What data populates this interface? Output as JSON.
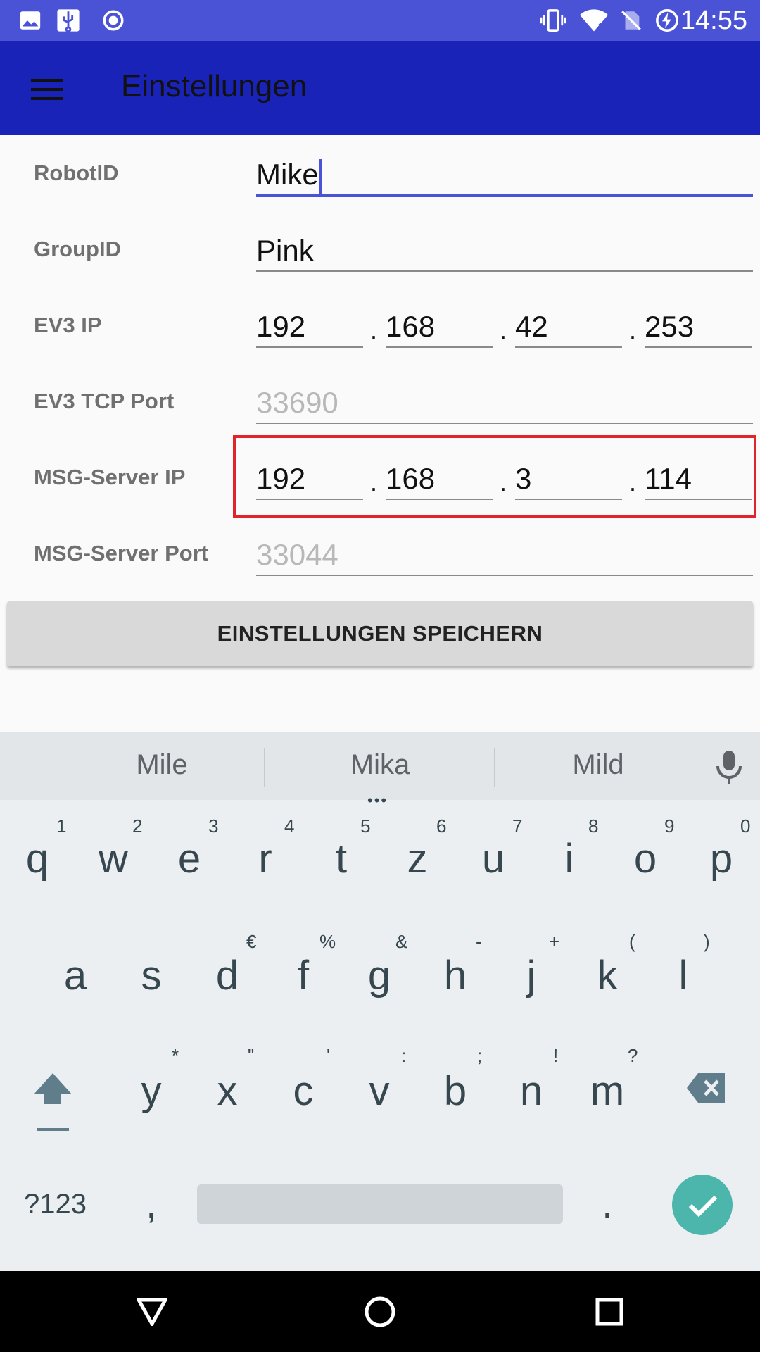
{
  "status_bar": {
    "time": "14:55",
    "left_icons": [
      "image-icon",
      "usb-icon",
      "record-icon"
    ],
    "right_icons": [
      "vibrate-icon",
      "wifi-icon",
      "no-sim-icon",
      "battery-charging-icon"
    ]
  },
  "app_bar": {
    "title": "Einstellungen",
    "menu_icon": "hamburger-icon"
  },
  "form": {
    "robot_id": {
      "label": "RobotID",
      "value": "Mike"
    },
    "group_id": {
      "label": "GroupID",
      "value": "Pink"
    },
    "ev3_ip": {
      "label": "EV3 IP",
      "octets": [
        "192",
        "168",
        "42",
        "253"
      ]
    },
    "ev3_tcp_port": {
      "label": "EV3 TCP Port",
      "placeholder": "33690"
    },
    "msg_server_ip": {
      "label": "MSG-Server IP",
      "octets": [
        "192",
        "168",
        "3",
        "114"
      ]
    },
    "msg_server_port": {
      "label": "MSG-Server Port",
      "placeholder": "33044"
    },
    "dot": ".",
    "save_label": "EINSTELLUNGEN SPEICHERN"
  },
  "keyboard": {
    "suggestions": [
      "Mile",
      "Mika",
      "Mild"
    ],
    "row1": [
      "q",
      "w",
      "e",
      "r",
      "t",
      "z",
      "u",
      "i",
      "o",
      "p"
    ],
    "row1_hints": [
      "1",
      "2",
      "3",
      "4",
      "5",
      "6",
      "7",
      "8",
      "9",
      "0"
    ],
    "row2": [
      "a",
      "s",
      "d",
      "f",
      "g",
      "h",
      "j",
      "k",
      "l"
    ],
    "row2_hints": [
      "",
      "",
      "€",
      "%",
      "&",
      "-",
      "+",
      "(",
      ")"
    ],
    "row3": [
      "y",
      "x",
      "c",
      "v",
      "b",
      "n",
      "m"
    ],
    "row3_hints": [
      "*",
      "\"",
      "'",
      ":",
      ";",
      "!",
      "?"
    ],
    "symbols_label": "?123",
    "comma": ",",
    "period": ".",
    "accent_color": "#4db6ac"
  },
  "nav_bar": {
    "icons": [
      "back-icon",
      "home-icon",
      "recents-icon"
    ]
  }
}
